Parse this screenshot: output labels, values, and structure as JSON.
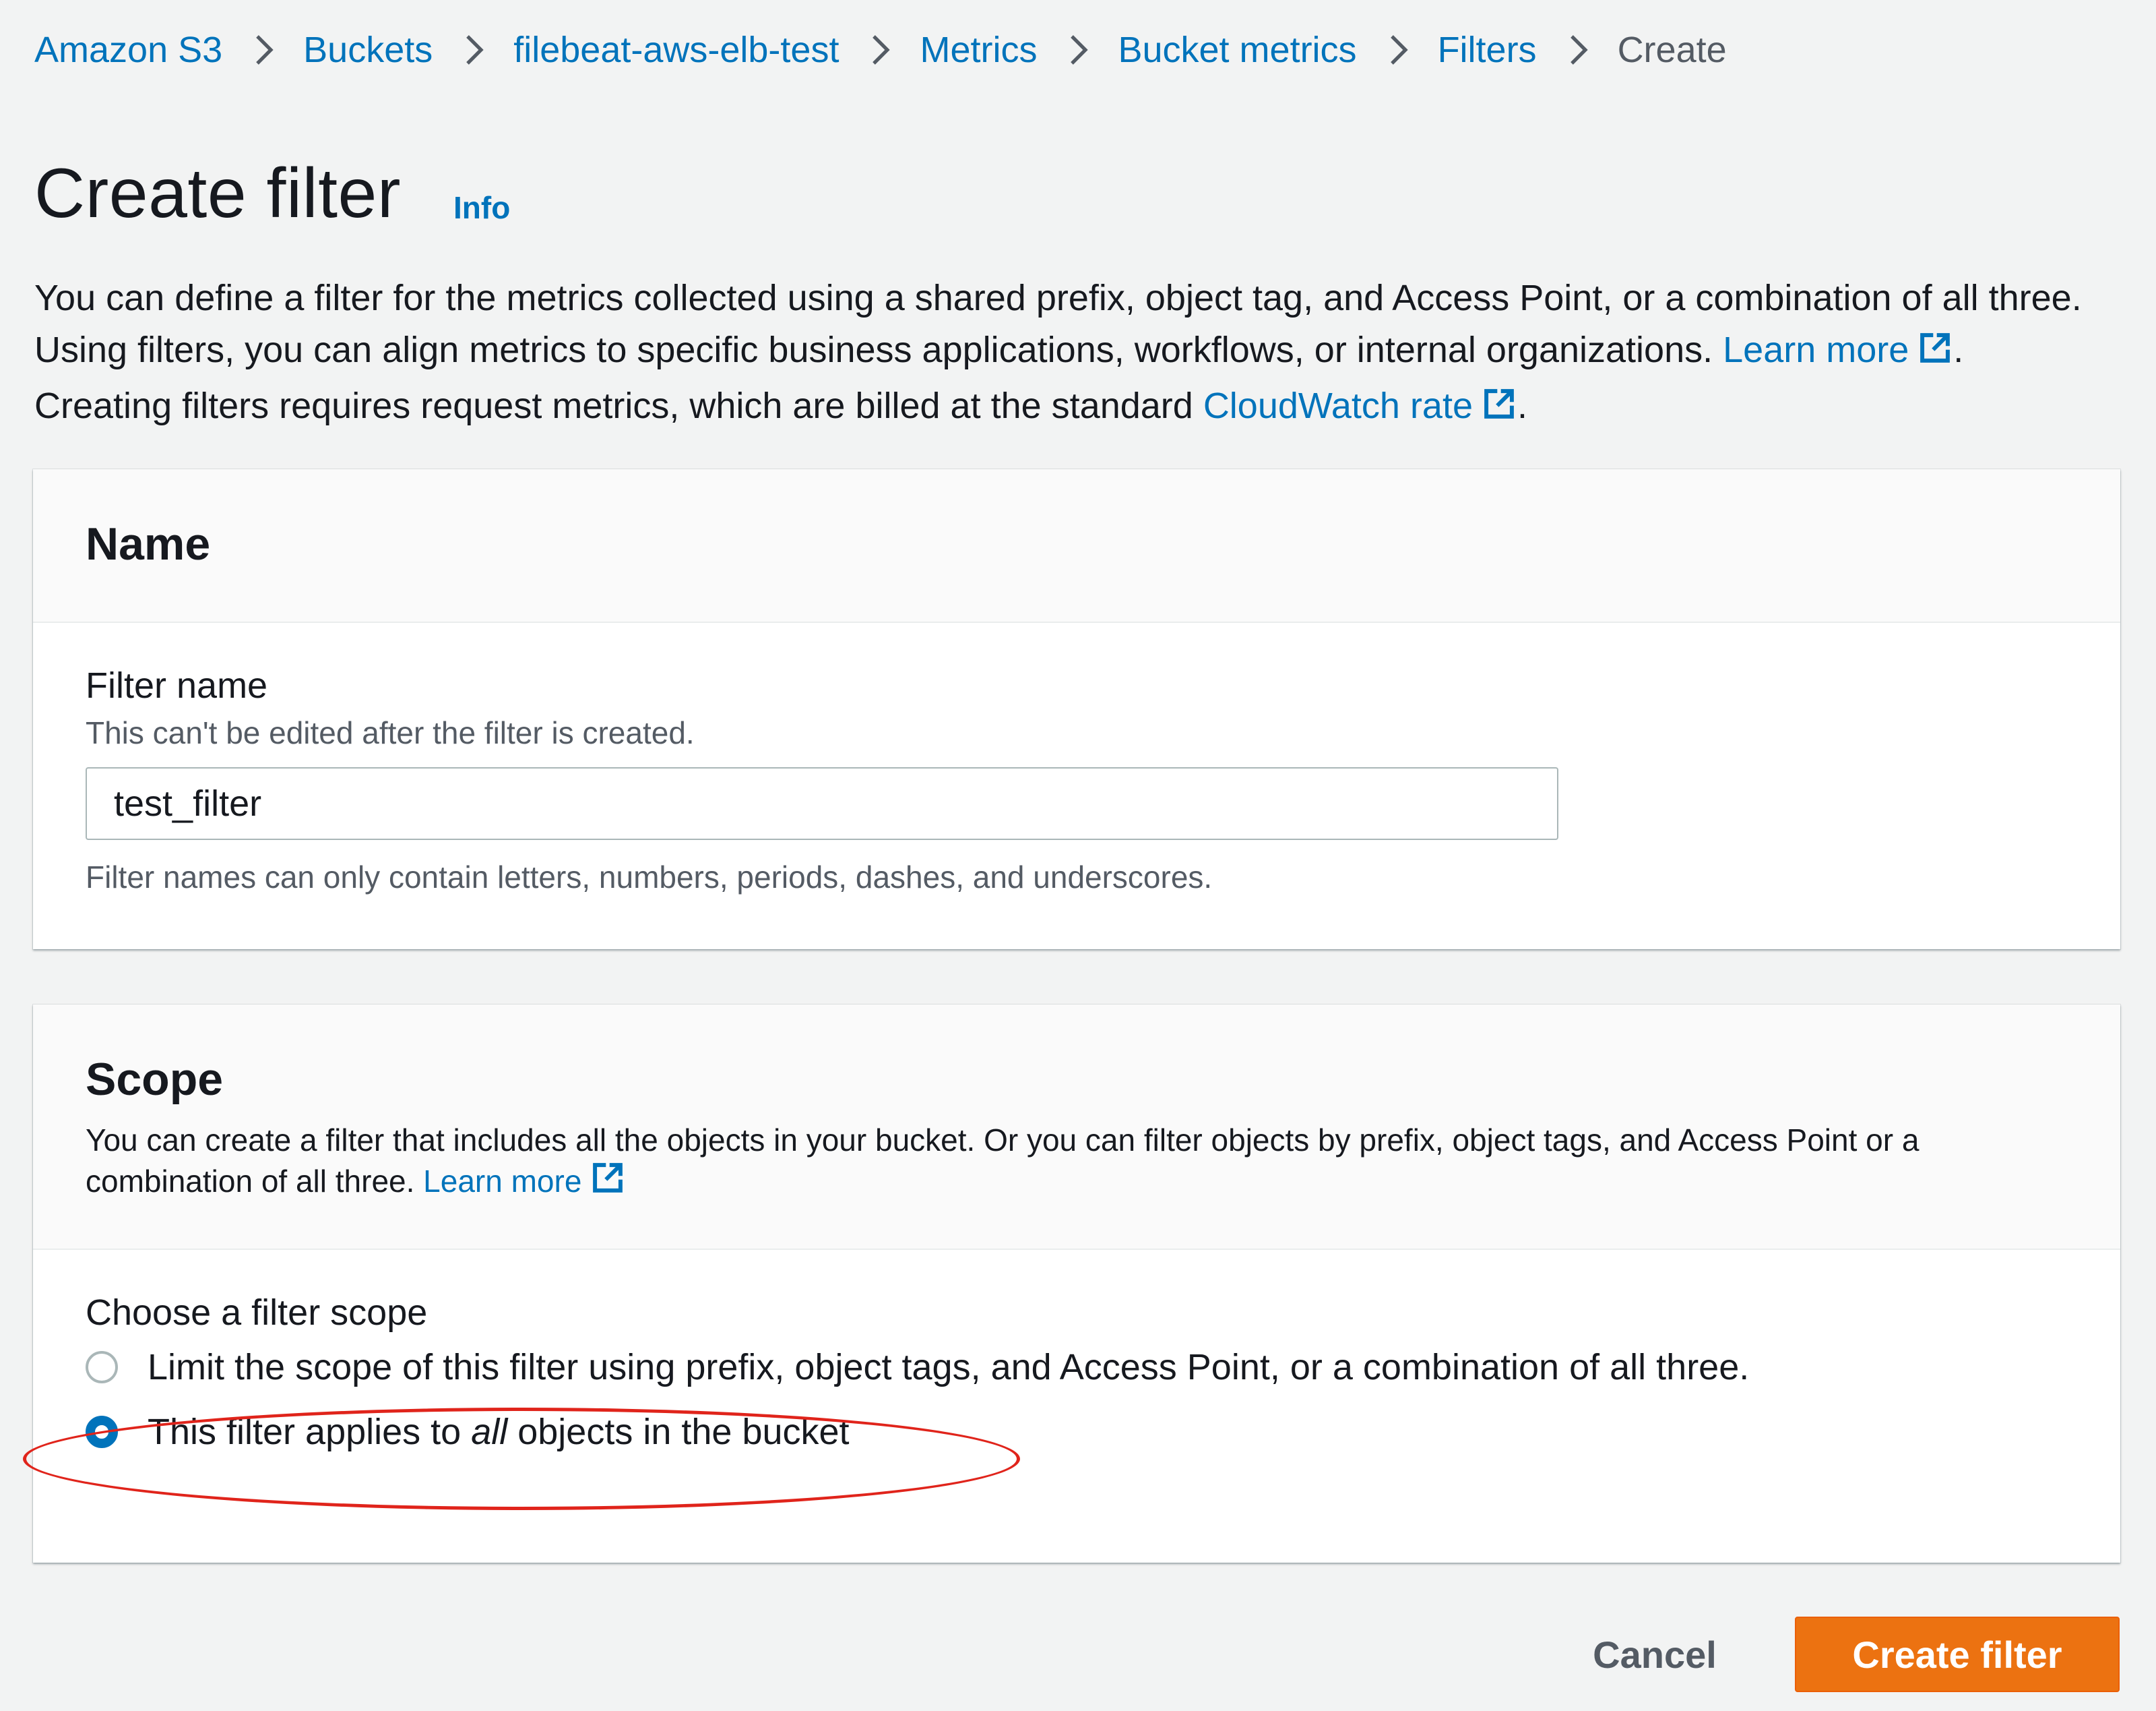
{
  "breadcrumb": [
    {
      "label": "Amazon S3"
    },
    {
      "label": "Buckets"
    },
    {
      "label": "filebeat-aws-elb-test"
    },
    {
      "label": "Metrics"
    },
    {
      "label": "Bucket metrics"
    },
    {
      "label": "Filters"
    },
    {
      "label": "Create"
    }
  ],
  "page": {
    "title": "Create filter",
    "info_link": "Info",
    "intro_part1": "You can define a filter for the metrics collected using a shared prefix, object tag, and Access Point, or a combination of all three. Using filters, you can align metrics to specific business applications, workflows, or internal organizations. ",
    "intro_learn_more": "Learn more",
    "intro_part2": ". Creating filters requires request metrics, which are billed at the standard ",
    "intro_cloudwatch": "CloudWatch rate",
    "intro_part3": "."
  },
  "name_panel": {
    "title": "Name",
    "filter_name_label": "Filter name",
    "filter_name_hint": "This can't be edited after the filter is created.",
    "filter_name_value": "test_filter",
    "filter_name_constraint": "Filter names can only contain letters, numbers, periods, dashes, and underscores."
  },
  "scope_panel": {
    "title": "Scope",
    "desc_part1": "You can create a filter that includes all the objects in your bucket. Or you can filter objects by prefix, object tags, and Access Point or a combination of all three. ",
    "desc_learn_more": "Learn more",
    "choose_label": "Choose a filter scope",
    "option_limit": "Limit the scope of this filter using prefix, object tags, and Access Point, or a combination of all three.",
    "option_all_before": "This filter applies to ",
    "option_all_emphasis": "all",
    "option_all_after": " objects in the bucket",
    "selected_option": "all"
  },
  "actions": {
    "cancel": "Cancel",
    "create": "Create filter"
  },
  "colors": {
    "link": "#0073bb",
    "primary_button": "#ec7211",
    "highlight_annotation": "#e0241b",
    "background": "#f2f3f3"
  }
}
